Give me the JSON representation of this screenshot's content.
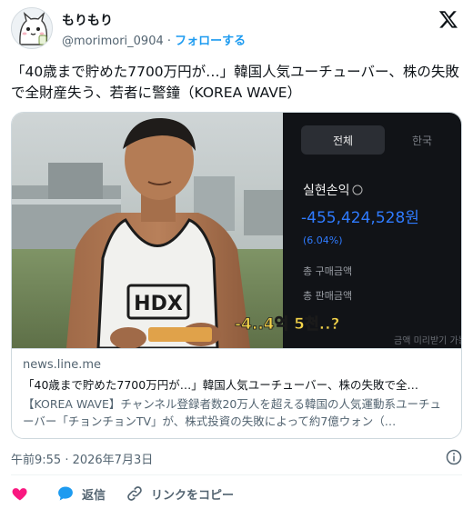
{
  "user": {
    "name": "もりもり",
    "handle": "@morimori_0904",
    "separator": "·",
    "follow_label": "フォローする"
  },
  "tweet": {
    "text": "「40歳まで貯めた7700万円が…」韓国人気ユーチューバー、株の失敗で全財産失う、若者に警鐘（KOREA WAVE）"
  },
  "card": {
    "domain": "news.line.me",
    "title": "「40歳まで貯めた7700万円が…」韓国人気ユーチューバー、株の失敗で全…",
    "description": "【KOREA WAVE】チャンネル登録者数20万人を超える韓国の人気運動系ユーチューバー「チョンチョンTV」が、株式投資の失敗によって約7億ウォン（…",
    "image": {
      "tab_all": "전체",
      "tab_korea": "한국",
      "pl_label": "실현손익",
      "pl_value": "-455,424,528원",
      "pl_percent": "(6.04%)",
      "buy_total": "총 구매금액",
      "sell_total": "총 판매금액",
      "shirt_logo": "HDX",
      "subtitle": "-4..4억 5천..?",
      "subtitle_bg": "금액 미리받기 가능"
    }
  },
  "meta": {
    "timestamp": "午前9:55 · 2026年7月3日"
  },
  "actions": {
    "reply_label": "返信",
    "copy_link_label": "リンクをコピー"
  },
  "colors": {
    "accent": "#1d9bf0",
    "like": "#f91880",
    "loss": "#2f7bff"
  }
}
